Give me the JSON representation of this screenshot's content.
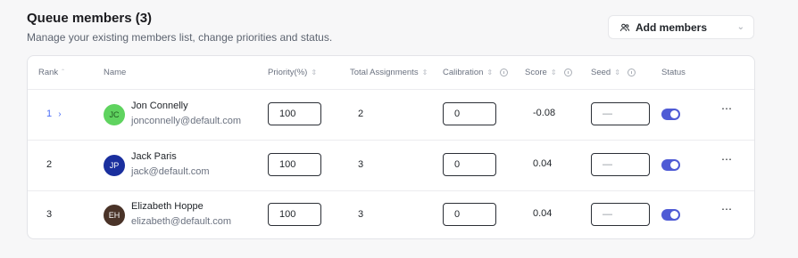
{
  "header": {
    "title": "Queue members (3)",
    "subtitle": "Manage your existing members list, change priorities and status.",
    "add_button_label": "Add members"
  },
  "table": {
    "columns": {
      "rank": "Rank",
      "name": "Name",
      "priority": "Priority(%)",
      "assignments": "Total Assignments",
      "calibration": "Calibration",
      "score": "Score",
      "seed": "Seed",
      "status": "Status"
    },
    "rows": [
      {
        "rank": "1",
        "initials": "JC",
        "name": "Jon Connelly",
        "email": "jonconnelly@default.com",
        "priority": "100",
        "assignments": "2",
        "calibration": "0",
        "score": "-0.08",
        "seed": "—",
        "status_on": true,
        "avatar_color": "#5fd35f"
      },
      {
        "rank": "2",
        "initials": "JP",
        "name": "Jack Paris",
        "email": "jack@default.com",
        "priority": "100",
        "assignments": "3",
        "calibration": "0",
        "score": "0.04",
        "seed": "—",
        "status_on": true,
        "avatar_color": "#1a2f9e"
      },
      {
        "rank": "3",
        "initials": "EH",
        "name": "Elizabeth Hoppe",
        "email": "elizabeth@default.com",
        "priority": "100",
        "assignments": "3",
        "calibration": "0",
        "score": "0.04",
        "seed": "—",
        "status_on": true,
        "avatar_color": "#4a3328"
      }
    ]
  },
  "colors": {
    "accent": "#4a6cf7",
    "toggle_on": "#4f5bd5"
  }
}
